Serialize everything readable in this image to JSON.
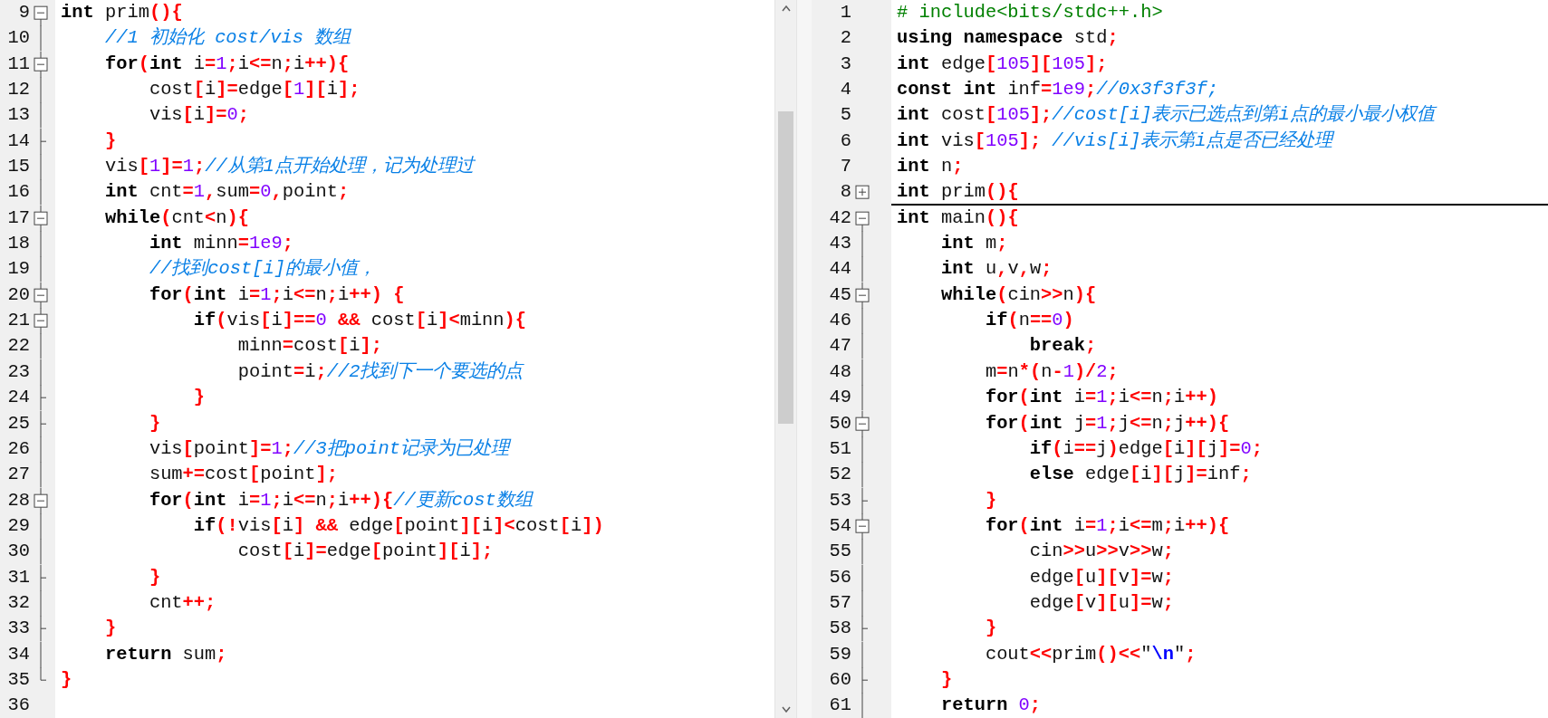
{
  "panes": [
    {
      "lines": [
        {
          "number": "9",
          "kind": "fold-start",
          "tokens": [
            {
              "kind": "k",
              "text": "int"
            },
            {
              "kind": "i",
              "text": " prim"
            },
            {
              "kind": "p",
              "text": "(){"
            }
          ]
        },
        {
          "number": "10",
          "kind": "fold-body",
          "tokens": [
            {
              "kind": "c",
              "text": "    //1 初始化 cost/vis 数组"
            }
          ]
        },
        {
          "number": "11",
          "kind": "fold-start",
          "tokens": [
            {
              "kind": "k",
              "text": "    for"
            },
            {
              "kind": "p",
              "text": "("
            },
            {
              "kind": "k",
              "text": "int"
            },
            {
              "kind": "i",
              "text": " i"
            },
            {
              "kind": "p",
              "text": "="
            },
            {
              "kind": "n",
              "text": "1"
            },
            {
              "kind": "p",
              "text": ";"
            },
            {
              "kind": "i",
              "text": "i"
            },
            {
              "kind": "p",
              "text": "<="
            },
            {
              "kind": "i",
              "text": "n"
            },
            {
              "kind": "p",
              "text": ";"
            },
            {
              "kind": "i",
              "text": "i"
            },
            {
              "kind": "p",
              "text": "++){"
            }
          ]
        },
        {
          "number": "12",
          "kind": "fold-body",
          "tokens": [
            {
              "kind": "i",
              "text": "        cost"
            },
            {
              "kind": "p",
              "text": "["
            },
            {
              "kind": "i",
              "text": "i"
            },
            {
              "kind": "p",
              "text": "]="
            },
            {
              "kind": "i",
              "text": "edge"
            },
            {
              "kind": "p",
              "text": "["
            },
            {
              "kind": "n",
              "text": "1"
            },
            {
              "kind": "p",
              "text": "]["
            },
            {
              "kind": "i",
              "text": "i"
            },
            {
              "kind": "p",
              "text": "];"
            }
          ]
        },
        {
          "number": "13",
          "kind": "fold-body",
          "tokens": [
            {
              "kind": "i",
              "text": "        vis"
            },
            {
              "kind": "p",
              "text": "["
            },
            {
              "kind": "i",
              "text": "i"
            },
            {
              "kind": "p",
              "text": "]="
            },
            {
              "kind": "n",
              "text": "0"
            },
            {
              "kind": "p",
              "text": ";"
            }
          ]
        },
        {
          "number": "14",
          "kind": "fold-end",
          "tokens": [
            {
              "kind": "p",
              "text": "    }"
            }
          ]
        },
        {
          "number": "15",
          "kind": "fold-body",
          "tokens": [
            {
              "kind": "i",
              "text": "    vis"
            },
            {
              "kind": "p",
              "text": "["
            },
            {
              "kind": "n",
              "text": "1"
            },
            {
              "kind": "p",
              "text": "]="
            },
            {
              "kind": "n",
              "text": "1"
            },
            {
              "kind": "p",
              "text": ";"
            },
            {
              "kind": "c",
              "text": "//从第1点开始处理，记为处理过"
            }
          ]
        },
        {
          "number": "16",
          "kind": "fold-body",
          "tokens": [
            {
              "kind": "k",
              "text": "    int"
            },
            {
              "kind": "i",
              "text": " cnt"
            },
            {
              "kind": "p",
              "text": "="
            },
            {
              "kind": "n",
              "text": "1"
            },
            {
              "kind": "p",
              "text": ","
            },
            {
              "kind": "i",
              "text": "sum"
            },
            {
              "kind": "p",
              "text": "="
            },
            {
              "kind": "n",
              "text": "0"
            },
            {
              "kind": "p",
              "text": ","
            },
            {
              "kind": "i",
              "text": "point"
            },
            {
              "kind": "p",
              "text": ";"
            }
          ]
        },
        {
          "number": "17",
          "kind": "fold-start",
          "tokens": [
            {
              "kind": "k",
              "text": "    while"
            },
            {
              "kind": "p",
              "text": "("
            },
            {
              "kind": "i",
              "text": "cnt"
            },
            {
              "kind": "p",
              "text": "<"
            },
            {
              "kind": "i",
              "text": "n"
            },
            {
              "kind": "p",
              "text": "){"
            }
          ]
        },
        {
          "number": "18",
          "kind": "fold-body",
          "tokens": [
            {
              "kind": "k",
              "text": "        int"
            },
            {
              "kind": "i",
              "text": " minn"
            },
            {
              "kind": "p",
              "text": "="
            },
            {
              "kind": "n",
              "text": "1e9"
            },
            {
              "kind": "p",
              "text": ";"
            }
          ]
        },
        {
          "number": "19",
          "kind": "fold-body",
          "tokens": [
            {
              "kind": "c",
              "text": "        //找到cost[i]的最小值，"
            }
          ]
        },
        {
          "number": "20",
          "kind": "fold-start",
          "tokens": [
            {
              "kind": "k",
              "text": "        for"
            },
            {
              "kind": "p",
              "text": "("
            },
            {
              "kind": "k",
              "text": "int"
            },
            {
              "kind": "i",
              "text": " i"
            },
            {
              "kind": "p",
              "text": "="
            },
            {
              "kind": "n",
              "text": "1"
            },
            {
              "kind": "p",
              "text": ";"
            },
            {
              "kind": "i",
              "text": "i"
            },
            {
              "kind": "p",
              "text": "<="
            },
            {
              "kind": "i",
              "text": "n"
            },
            {
              "kind": "p",
              "text": ";"
            },
            {
              "kind": "i",
              "text": "i"
            },
            {
              "kind": "p",
              "text": "++) {"
            }
          ]
        },
        {
          "number": "21",
          "kind": "fold-start",
          "tokens": [
            {
              "kind": "k",
              "text": "            if"
            },
            {
              "kind": "p",
              "text": "("
            },
            {
              "kind": "i",
              "text": "vis"
            },
            {
              "kind": "p",
              "text": "["
            },
            {
              "kind": "i",
              "text": "i"
            },
            {
              "kind": "p",
              "text": "]=="
            },
            {
              "kind": "n",
              "text": "0"
            },
            {
              "kind": "p",
              "text": " &&"
            },
            {
              "kind": "i",
              "text": " cost"
            },
            {
              "kind": "p",
              "text": "["
            },
            {
              "kind": "i",
              "text": "i"
            },
            {
              "kind": "p",
              "text": "]<"
            },
            {
              "kind": "i",
              "text": "minn"
            },
            {
              "kind": "p",
              "text": "){"
            }
          ]
        },
        {
          "number": "22",
          "kind": "fold-body",
          "tokens": [
            {
              "kind": "i",
              "text": "                minn"
            },
            {
              "kind": "p",
              "text": "="
            },
            {
              "kind": "i",
              "text": "cost"
            },
            {
              "kind": "p",
              "text": "["
            },
            {
              "kind": "i",
              "text": "i"
            },
            {
              "kind": "p",
              "text": "];"
            }
          ]
        },
        {
          "number": "23",
          "kind": "fold-body",
          "tokens": [
            {
              "kind": "i",
              "text": "                point"
            },
            {
              "kind": "p",
              "text": "="
            },
            {
              "kind": "i",
              "text": "i"
            },
            {
              "kind": "p",
              "text": ";"
            },
            {
              "kind": "c",
              "text": "//2找到下一个要选的点"
            }
          ]
        },
        {
          "number": "24",
          "kind": "fold-end",
          "tokens": [
            {
              "kind": "p",
              "text": "            }"
            }
          ]
        },
        {
          "number": "25",
          "kind": "fold-end",
          "tokens": [
            {
              "kind": "p",
              "text": "        }"
            }
          ]
        },
        {
          "number": "26",
          "kind": "fold-body",
          "tokens": [
            {
              "kind": "i",
              "text": "        vis"
            },
            {
              "kind": "p",
              "text": "["
            },
            {
              "kind": "i",
              "text": "point"
            },
            {
              "kind": "p",
              "text": "]="
            },
            {
              "kind": "n",
              "text": "1"
            },
            {
              "kind": "p",
              "text": ";"
            },
            {
              "kind": "c",
              "text": "//3把point记录为已处理"
            }
          ]
        },
        {
          "number": "27",
          "kind": "fold-body",
          "tokens": [
            {
              "kind": "i",
              "text": "        sum"
            },
            {
              "kind": "p",
              "text": "+="
            },
            {
              "kind": "i",
              "text": "cost"
            },
            {
              "kind": "p",
              "text": "["
            },
            {
              "kind": "i",
              "text": "point"
            },
            {
              "kind": "p",
              "text": "];"
            }
          ]
        },
        {
          "number": "28",
          "kind": "fold-start",
          "tokens": [
            {
              "kind": "k",
              "text": "        for"
            },
            {
              "kind": "p",
              "text": "("
            },
            {
              "kind": "k",
              "text": "int"
            },
            {
              "kind": "i",
              "text": " i"
            },
            {
              "kind": "p",
              "text": "="
            },
            {
              "kind": "n",
              "text": "1"
            },
            {
              "kind": "p",
              "text": ";"
            },
            {
              "kind": "i",
              "text": "i"
            },
            {
              "kind": "p",
              "text": "<="
            },
            {
              "kind": "i",
              "text": "n"
            },
            {
              "kind": "p",
              "text": ";"
            },
            {
              "kind": "i",
              "text": "i"
            },
            {
              "kind": "p",
              "text": "++){"
            },
            {
              "kind": "c",
              "text": "//更新cost数组"
            }
          ]
        },
        {
          "number": "29",
          "kind": "fold-body",
          "tokens": [
            {
              "kind": "k",
              "text": "            if"
            },
            {
              "kind": "p",
              "text": "(!"
            },
            {
              "kind": "i",
              "text": "vis"
            },
            {
              "kind": "p",
              "text": "["
            },
            {
              "kind": "i",
              "text": "i"
            },
            {
              "kind": "p",
              "text": "] &&"
            },
            {
              "kind": "i",
              "text": " edge"
            },
            {
              "kind": "p",
              "text": "["
            },
            {
              "kind": "i",
              "text": "point"
            },
            {
              "kind": "p",
              "text": "]["
            },
            {
              "kind": "i",
              "text": "i"
            },
            {
              "kind": "p",
              "text": "]<"
            },
            {
              "kind": "i",
              "text": "cost"
            },
            {
              "kind": "p",
              "text": "["
            },
            {
              "kind": "i",
              "text": "i"
            },
            {
              "kind": "p",
              "text": "])"
            }
          ]
        },
        {
          "number": "30",
          "kind": "fold-body",
          "tokens": [
            {
              "kind": "i",
              "text": "                cost"
            },
            {
              "kind": "p",
              "text": "["
            },
            {
              "kind": "i",
              "text": "i"
            },
            {
              "kind": "p",
              "text": "]="
            },
            {
              "kind": "i",
              "text": "edge"
            },
            {
              "kind": "p",
              "text": "["
            },
            {
              "kind": "i",
              "text": "point"
            },
            {
              "kind": "p",
              "text": "]["
            },
            {
              "kind": "i",
              "text": "i"
            },
            {
              "kind": "p",
              "text": "];"
            }
          ]
        },
        {
          "number": "31",
          "kind": "fold-end",
          "tokens": [
            {
              "kind": "p",
              "text": "        }"
            }
          ]
        },
        {
          "number": "32",
          "kind": "fold-body",
          "tokens": [
            {
              "kind": "i",
              "text": "        cnt"
            },
            {
              "kind": "p",
              "text": "++;"
            }
          ]
        },
        {
          "number": "33",
          "kind": "fold-end",
          "tokens": [
            {
              "kind": "p",
              "text": "    }"
            }
          ]
        },
        {
          "number": "34",
          "kind": "fold-body",
          "tokens": [
            {
              "kind": "k",
              "text": "    return"
            },
            {
              "kind": "i",
              "text": " sum"
            },
            {
              "kind": "p",
              "text": ";"
            }
          ]
        },
        {
          "number": "35",
          "kind": "fold-last",
          "tokens": [
            {
              "kind": "p",
              "text": "}"
            }
          ]
        },
        {
          "number": "36",
          "kind": "plain"
        }
      ]
    },
    {
      "lines": [
        {
          "number": "1",
          "kind": "plain",
          "tokens": [
            {
              "kind": "d",
              "text": "# include<bits/stdc++.h>"
            }
          ]
        },
        {
          "number": "2",
          "kind": "plain",
          "tokens": [
            {
              "kind": "k",
              "text": "using namespace"
            },
            {
              "kind": "i",
              "text": " std"
            },
            {
              "kind": "p",
              "text": ";"
            }
          ]
        },
        {
          "number": "3",
          "kind": "plain",
          "tokens": [
            {
              "kind": "k",
              "text": "int"
            },
            {
              "kind": "i",
              "text": " edge"
            },
            {
              "kind": "p",
              "text": "["
            },
            {
              "kind": "n",
              "text": "105"
            },
            {
              "kind": "p",
              "text": "]["
            },
            {
              "kind": "n",
              "text": "105"
            },
            {
              "kind": "p",
              "text": "];"
            }
          ]
        },
        {
          "number": "4",
          "kind": "plain",
          "tokens": [
            {
              "kind": "k",
              "text": "const int"
            },
            {
              "kind": "i",
              "text": " inf"
            },
            {
              "kind": "p",
              "text": "="
            },
            {
              "kind": "n",
              "text": "1e9"
            },
            {
              "kind": "p",
              "text": ";"
            },
            {
              "kind": "c",
              "text": "//0x3f3f3f;"
            }
          ]
        },
        {
          "number": "5",
          "kind": "plain",
          "tokens": [
            {
              "kind": "k",
              "text": "int"
            },
            {
              "kind": "i",
              "text": " cost"
            },
            {
              "kind": "p",
              "text": "["
            },
            {
              "kind": "n",
              "text": "105"
            },
            {
              "kind": "p",
              "text": "];"
            },
            {
              "kind": "c",
              "text": "//cost[i]表示已选点到第i点的最小最小权值"
            }
          ]
        },
        {
          "number": "6",
          "kind": "plain",
          "tokens": [
            {
              "kind": "k",
              "text": "int"
            },
            {
              "kind": "i",
              "text": " vis"
            },
            {
              "kind": "p",
              "text": "["
            },
            {
              "kind": "n",
              "text": "105"
            },
            {
              "kind": "p",
              "text": "];"
            },
            {
              "kind": "c",
              "text": " //vis[i]表示第i点是否已经处理"
            }
          ]
        },
        {
          "number": "7",
          "kind": "plain",
          "tokens": [
            {
              "kind": "k",
              "text": "int"
            },
            {
              "kind": "i",
              "text": " n"
            },
            {
              "kind": "p",
              "text": ";"
            }
          ]
        },
        {
          "number": "8",
          "kind": "fold-closed",
          "tokens": [
            {
              "kind": "k",
              "text": "int"
            },
            {
              "kind": "i",
              "text": " prim"
            },
            {
              "kind": "p",
              "text": "(){"
            }
          ]
        },
        {
          "number": "42",
          "kind": "fold-start",
          "tokens": [
            {
              "kind": "k",
              "text": "int"
            },
            {
              "kind": "i",
              "text": " main"
            },
            {
              "kind": "p",
              "text": "(){"
            }
          ]
        },
        {
          "number": "43",
          "kind": "fold-body",
          "tokens": [
            {
              "kind": "k",
              "text": "    int"
            },
            {
              "kind": "i",
              "text": " m"
            },
            {
              "kind": "p",
              "text": ";"
            }
          ]
        },
        {
          "number": "44",
          "kind": "fold-body",
          "tokens": [
            {
              "kind": "k",
              "text": "    int"
            },
            {
              "kind": "i",
              "text": " u"
            },
            {
              "kind": "p",
              "text": ","
            },
            {
              "kind": "i",
              "text": "v"
            },
            {
              "kind": "p",
              "text": ","
            },
            {
              "kind": "i",
              "text": "w"
            },
            {
              "kind": "p",
              "text": ";"
            }
          ]
        },
        {
          "number": "45",
          "kind": "fold-start",
          "tokens": [
            {
              "kind": "k",
              "text": "    while"
            },
            {
              "kind": "p",
              "text": "("
            },
            {
              "kind": "i",
              "text": "cin"
            },
            {
              "kind": "p",
              "text": ">>"
            },
            {
              "kind": "i",
              "text": "n"
            },
            {
              "kind": "p",
              "text": "){"
            }
          ]
        },
        {
          "number": "46",
          "kind": "fold-body",
          "tokens": [
            {
              "kind": "k",
              "text": "        if"
            },
            {
              "kind": "p",
              "text": "("
            },
            {
              "kind": "i",
              "text": "n"
            },
            {
              "kind": "p",
              "text": "=="
            },
            {
              "kind": "n",
              "text": "0"
            },
            {
              "kind": "p",
              "text": ")"
            }
          ]
        },
        {
          "number": "47",
          "kind": "fold-body",
          "tokens": [
            {
              "kind": "k",
              "text": "            break"
            },
            {
              "kind": "p",
              "text": ";"
            }
          ]
        },
        {
          "number": "48",
          "kind": "fold-body",
          "tokens": [
            {
              "kind": "i",
              "text": "        m"
            },
            {
              "kind": "p",
              "text": "="
            },
            {
              "kind": "i",
              "text": "n"
            },
            {
              "kind": "p",
              "text": "*("
            },
            {
              "kind": "i",
              "text": "n"
            },
            {
              "kind": "p",
              "text": "-"
            },
            {
              "kind": "n",
              "text": "1"
            },
            {
              "kind": "p",
              "text": ")/"
            },
            {
              "kind": "n",
              "text": "2"
            },
            {
              "kind": "p",
              "text": ";"
            }
          ]
        },
        {
          "number": "49",
          "kind": "fold-body",
          "tokens": [
            {
              "kind": "k",
              "text": "        for"
            },
            {
              "kind": "p",
              "text": "("
            },
            {
              "kind": "k",
              "text": "int"
            },
            {
              "kind": "i",
              "text": " i"
            },
            {
              "kind": "p",
              "text": "="
            },
            {
              "kind": "n",
              "text": "1"
            },
            {
              "kind": "p",
              "text": ";"
            },
            {
              "kind": "i",
              "text": "i"
            },
            {
              "kind": "p",
              "text": "<="
            },
            {
              "kind": "i",
              "text": "n"
            },
            {
              "kind": "p",
              "text": ";"
            },
            {
              "kind": "i",
              "text": "i"
            },
            {
              "kind": "p",
              "text": "++)"
            }
          ]
        },
        {
          "number": "50",
          "kind": "fold-start",
          "tokens": [
            {
              "kind": "k",
              "text": "        for"
            },
            {
              "kind": "p",
              "text": "("
            },
            {
              "kind": "k",
              "text": "int"
            },
            {
              "kind": "i",
              "text": " j"
            },
            {
              "kind": "p",
              "text": "="
            },
            {
              "kind": "n",
              "text": "1"
            },
            {
              "kind": "p",
              "text": ";"
            },
            {
              "kind": "i",
              "text": "j"
            },
            {
              "kind": "p",
              "text": "<="
            },
            {
              "kind": "i",
              "text": "n"
            },
            {
              "kind": "p",
              "text": ";"
            },
            {
              "kind": "i",
              "text": "j"
            },
            {
              "kind": "p",
              "text": "++){"
            }
          ]
        },
        {
          "number": "51",
          "kind": "fold-body",
          "tokens": [
            {
              "kind": "k",
              "text": "            if"
            },
            {
              "kind": "p",
              "text": "("
            },
            {
              "kind": "i",
              "text": "i"
            },
            {
              "kind": "p",
              "text": "=="
            },
            {
              "kind": "i",
              "text": "j"
            },
            {
              "kind": "p",
              "text": ")"
            },
            {
              "kind": "i",
              "text": "edge"
            },
            {
              "kind": "p",
              "text": "["
            },
            {
              "kind": "i",
              "text": "i"
            },
            {
              "kind": "p",
              "text": "]["
            },
            {
              "kind": "i",
              "text": "j"
            },
            {
              "kind": "p",
              "text": "]="
            },
            {
              "kind": "n",
              "text": "0"
            },
            {
              "kind": "p",
              "text": ";"
            }
          ]
        },
        {
          "number": "52",
          "kind": "fold-body",
          "tokens": [
            {
              "kind": "k",
              "text": "            else"
            },
            {
              "kind": "i",
              "text": " edge"
            },
            {
              "kind": "p",
              "text": "["
            },
            {
              "kind": "i",
              "text": "i"
            },
            {
              "kind": "p",
              "text": "]["
            },
            {
              "kind": "i",
              "text": "j"
            },
            {
              "kind": "p",
              "text": "]="
            },
            {
              "kind": "i",
              "text": "inf"
            },
            {
              "kind": "p",
              "text": ";"
            }
          ]
        },
        {
          "number": "53",
          "kind": "fold-end",
          "tokens": [
            {
              "kind": "p",
              "text": "        }"
            }
          ]
        },
        {
          "number": "54",
          "kind": "fold-start",
          "tokens": [
            {
              "kind": "k",
              "text": "        for"
            },
            {
              "kind": "p",
              "text": "("
            },
            {
              "kind": "k",
              "text": "int"
            },
            {
              "kind": "i",
              "text": " i"
            },
            {
              "kind": "p",
              "text": "="
            },
            {
              "kind": "n",
              "text": "1"
            },
            {
              "kind": "p",
              "text": ";"
            },
            {
              "kind": "i",
              "text": "i"
            },
            {
              "kind": "p",
              "text": "<="
            },
            {
              "kind": "i",
              "text": "m"
            },
            {
              "kind": "p",
              "text": ";"
            },
            {
              "kind": "i",
              "text": "i"
            },
            {
              "kind": "p",
              "text": "++){"
            }
          ]
        },
        {
          "number": "55",
          "kind": "fold-body",
          "tokens": [
            {
              "kind": "i",
              "text": "            cin"
            },
            {
              "kind": "p",
              "text": ">>"
            },
            {
              "kind": "i",
              "text": "u"
            },
            {
              "kind": "p",
              "text": ">>"
            },
            {
              "kind": "i",
              "text": "v"
            },
            {
              "kind": "p",
              "text": ">>"
            },
            {
              "kind": "i",
              "text": "w"
            },
            {
              "kind": "p",
              "text": ";"
            }
          ]
        },
        {
          "number": "56",
          "kind": "fold-body",
          "tokens": [
            {
              "kind": "i",
              "text": "            edge"
            },
            {
              "kind": "p",
              "text": "["
            },
            {
              "kind": "i",
              "text": "u"
            },
            {
              "kind": "p",
              "text": "]["
            },
            {
              "kind": "i",
              "text": "v"
            },
            {
              "kind": "p",
              "text": "]="
            },
            {
              "kind": "i",
              "text": "w"
            },
            {
              "kind": "p",
              "text": ";"
            }
          ]
        },
        {
          "number": "57",
          "kind": "fold-body",
          "tokens": [
            {
              "kind": "i",
              "text": "            edge"
            },
            {
              "kind": "p",
              "text": "["
            },
            {
              "kind": "i",
              "text": "v"
            },
            {
              "kind": "p",
              "text": "]["
            },
            {
              "kind": "i",
              "text": "u"
            },
            {
              "kind": "p",
              "text": "]="
            },
            {
              "kind": "i",
              "text": "w"
            },
            {
              "kind": "p",
              "text": ";"
            }
          ]
        },
        {
          "number": "58",
          "kind": "fold-end",
          "tokens": [
            {
              "kind": "p",
              "text": "        }"
            }
          ]
        },
        {
          "number": "59",
          "kind": "fold-body",
          "tokens": [
            {
              "kind": "i",
              "text": "        cout"
            },
            {
              "kind": "p",
              "text": "<<"
            },
            {
              "kind": "i",
              "text": "prim"
            },
            {
              "kind": "p",
              "text": "()<<"
            },
            {
              "kind": "i",
              "text": "\""
            },
            {
              "kind": "s",
              "text": "\\n"
            },
            {
              "kind": "i",
              "text": "\""
            },
            {
              "kind": "p",
              "text": ";"
            }
          ]
        },
        {
          "number": "60",
          "kind": "fold-end",
          "tokens": [
            {
              "kind": "p",
              "text": "    }"
            }
          ]
        },
        {
          "number": "61",
          "kind": "fold-body",
          "tokens": [
            {
              "kind": "k",
              "text": "    return"
            },
            {
              "kind": "n",
              "text": " 0"
            },
            {
              "kind": "p",
              "text": ";"
            }
          ]
        }
      ]
    }
  ]
}
